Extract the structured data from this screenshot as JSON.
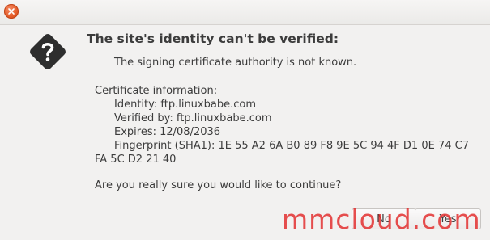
{
  "dialog": {
    "heading": "The site's identity can't be verified:",
    "subline": "The signing certificate authority is not known.",
    "certificate_header": "Certificate information:",
    "identity": "Identity: ftp.linuxbabe.com",
    "verified_by": "Verified by: ftp.linuxbabe.com",
    "expires": "Expires: 12/08/2036",
    "fingerprint_line1": "Fingerprint (SHA1): 1E 55 A2 6A B0 89 F8 9E 5C 94 4F D1 0E 74 C7",
    "fingerprint_line2": "FA 5C D2 21 40",
    "question": "Are you really sure you would like to continue?"
  },
  "buttons": {
    "no_label": "No",
    "yes_label": "Yes"
  },
  "watermark": "mmcloud.com",
  "icons": {
    "close": "close-icon",
    "dialog": "question-diamond-icon"
  },
  "colors": {
    "close_button": "#e0531d",
    "icon": "#2e2e2e",
    "watermark": "#e22828"
  }
}
